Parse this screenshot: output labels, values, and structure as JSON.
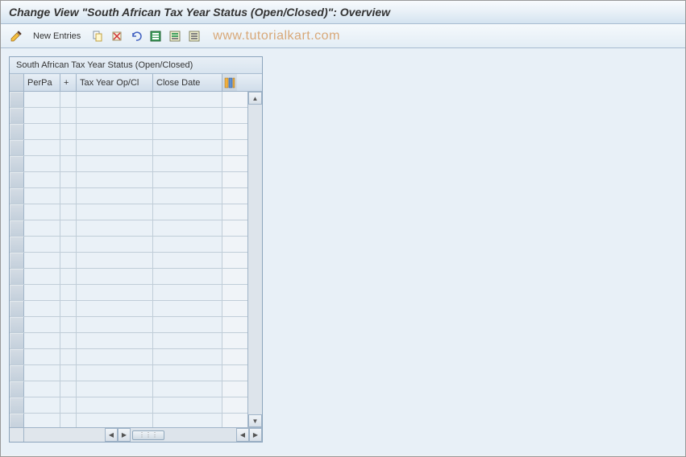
{
  "title": "Change View \"South African Tax Year Status (Open/Closed)\": Overview",
  "toolbar": {
    "new_entries_label": "New Entries"
  },
  "watermark": "www.tutorialkart.com",
  "table": {
    "caption": "South African Tax Year Status (Open/Closed)",
    "columns": {
      "perpa": "PerPa",
      "plus": "+",
      "taxyear": "Tax Year Op/Cl",
      "closedate": "Close Date"
    },
    "rows": [
      {
        "perpa": "",
        "plus": "",
        "taxyear": "",
        "closedate": ""
      },
      {
        "perpa": "",
        "plus": "",
        "taxyear": "",
        "closedate": ""
      },
      {
        "perpa": "",
        "plus": "",
        "taxyear": "",
        "closedate": ""
      },
      {
        "perpa": "",
        "plus": "",
        "taxyear": "",
        "closedate": ""
      },
      {
        "perpa": "",
        "plus": "",
        "taxyear": "",
        "closedate": ""
      },
      {
        "perpa": "",
        "plus": "",
        "taxyear": "",
        "closedate": ""
      },
      {
        "perpa": "",
        "plus": "",
        "taxyear": "",
        "closedate": ""
      },
      {
        "perpa": "",
        "plus": "",
        "taxyear": "",
        "closedate": ""
      },
      {
        "perpa": "",
        "plus": "",
        "taxyear": "",
        "closedate": ""
      },
      {
        "perpa": "",
        "plus": "",
        "taxyear": "",
        "closedate": ""
      },
      {
        "perpa": "",
        "plus": "",
        "taxyear": "",
        "closedate": ""
      },
      {
        "perpa": "",
        "plus": "",
        "taxyear": "",
        "closedate": ""
      },
      {
        "perpa": "",
        "plus": "",
        "taxyear": "",
        "closedate": ""
      },
      {
        "perpa": "",
        "plus": "",
        "taxyear": "",
        "closedate": ""
      },
      {
        "perpa": "",
        "plus": "",
        "taxyear": "",
        "closedate": ""
      },
      {
        "perpa": "",
        "plus": "",
        "taxyear": "",
        "closedate": ""
      },
      {
        "perpa": "",
        "plus": "",
        "taxyear": "",
        "closedate": ""
      },
      {
        "perpa": "",
        "plus": "",
        "taxyear": "",
        "closedate": ""
      },
      {
        "perpa": "",
        "plus": "",
        "taxyear": "",
        "closedate": ""
      },
      {
        "perpa": "",
        "plus": "",
        "taxyear": "",
        "closedate": ""
      },
      {
        "perpa": "",
        "plus": "",
        "taxyear": "",
        "closedate": ""
      }
    ]
  }
}
